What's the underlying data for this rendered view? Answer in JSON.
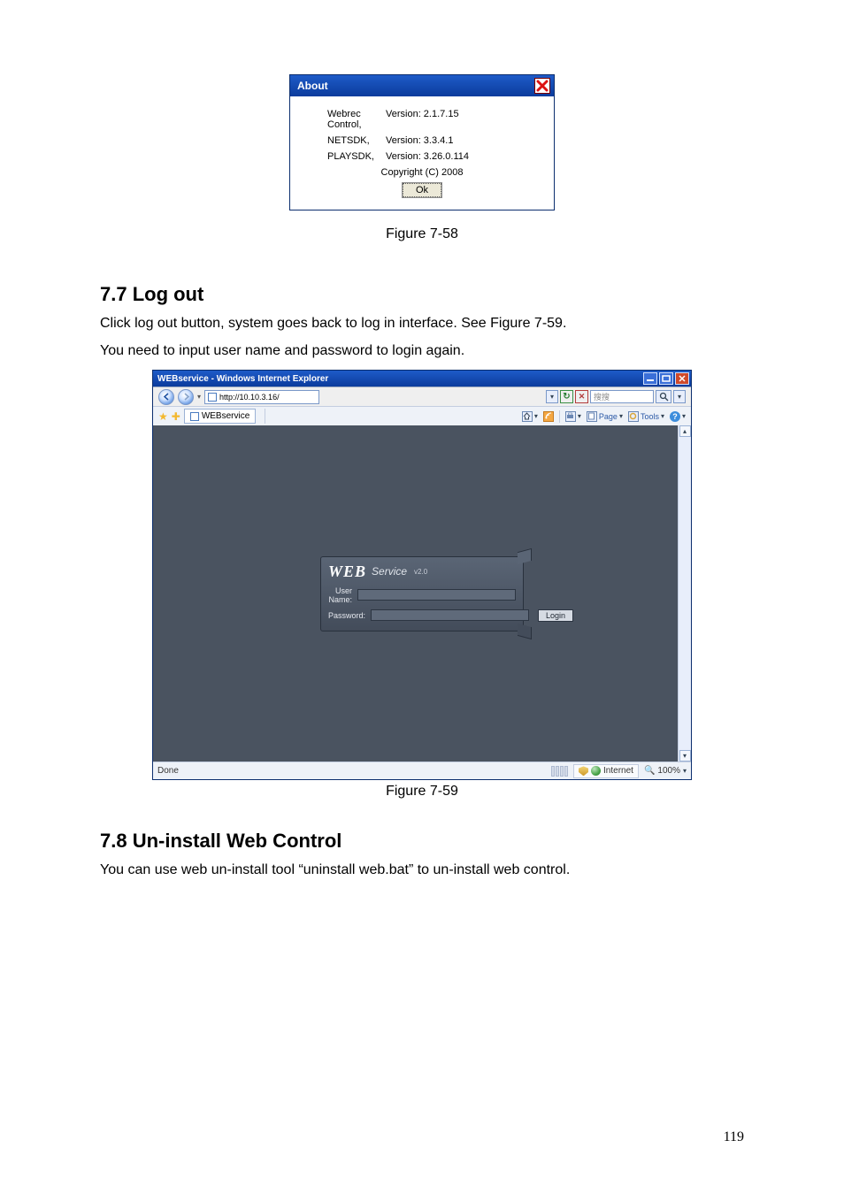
{
  "about": {
    "title": "About",
    "rows": [
      {
        "label": "Webrec Control,",
        "value": "Version: 2.1.7.15"
      },
      {
        "label": "NETSDK,",
        "value": "Version: 3.3.4.1"
      },
      {
        "label": "PLAYSDK,",
        "value": "Version: 3.26.0.114"
      }
    ],
    "copyright": "Copyright (C) 2008",
    "ok": "Ok"
  },
  "caption1": "Figure 7-58",
  "section77": {
    "heading": "7.7  Log out",
    "p1": "Click log out button, system goes back to log in interface. See Figure 7-59.",
    "p2": "You need to input user name and password to login again."
  },
  "ie": {
    "title": "WEBservice - Windows Internet Explorer",
    "url": "http://10.10.3.16/",
    "search_placeholder": "搜搜",
    "tab_label": "WEBservice",
    "toolbar": {
      "page": "Page",
      "tools": "Tools"
    },
    "login": {
      "brand_web": "WEB",
      "brand_service": "Service",
      "brand_small": "v2.0",
      "user_label": "User Name:",
      "pass_label": "Password:",
      "login_btn": "Login"
    },
    "status": {
      "done": "Done",
      "zone": "Internet",
      "zoom": "100%"
    }
  },
  "caption2": "Figure 7-59",
  "section78": {
    "heading": "7.8  Un-install Web Control",
    "p1": "You can use web un-install tool “uninstall web.bat” to un-install web control."
  },
  "page_number": "119"
}
